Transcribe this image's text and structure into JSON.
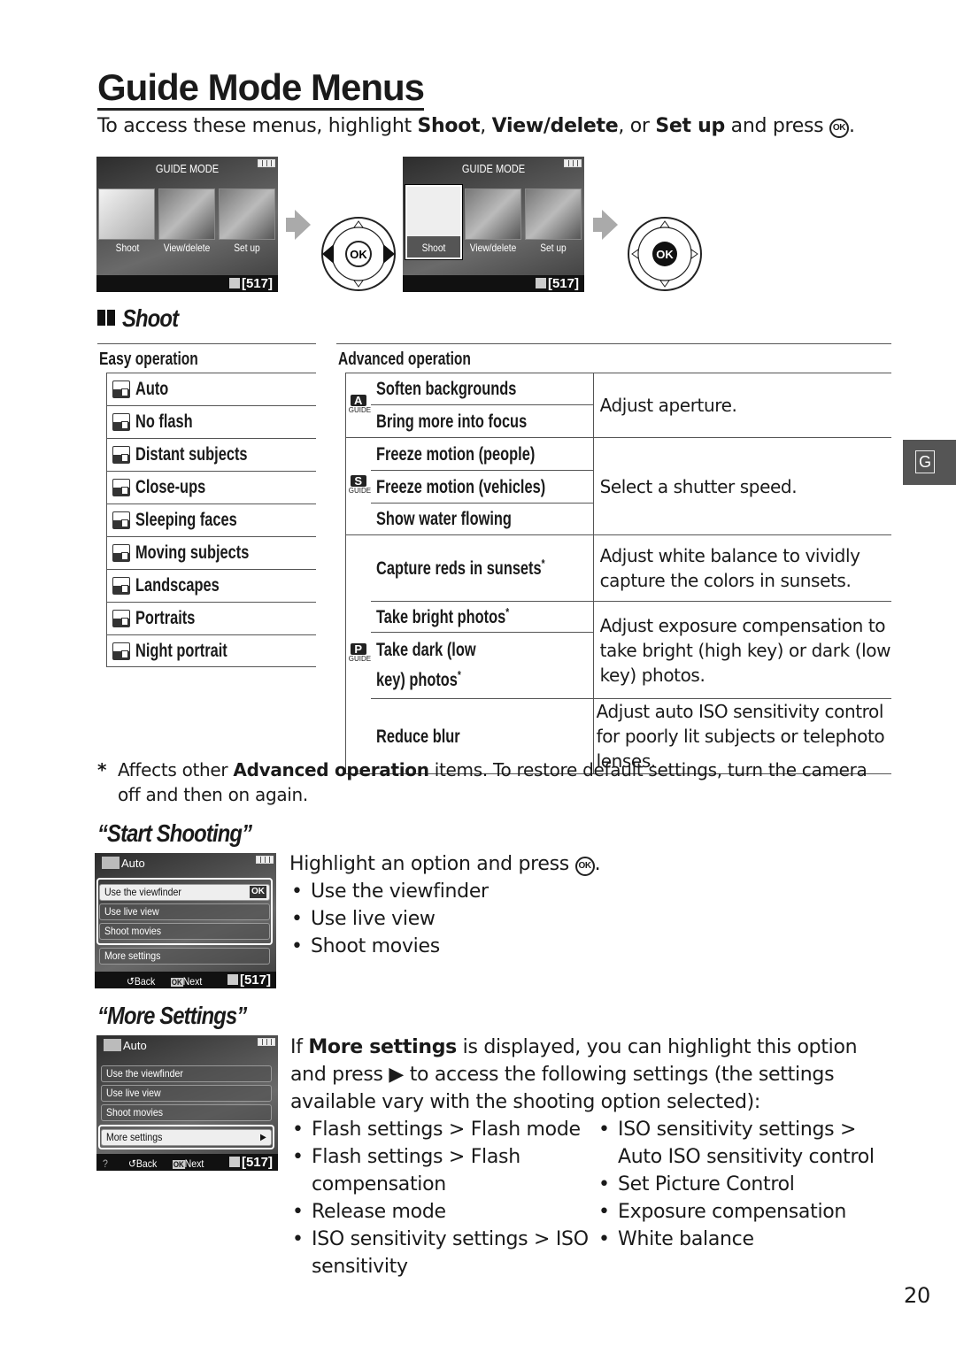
{
  "title": "Guide Mode Menus",
  "intro": {
    "t1": "To access these menus, highlight ",
    "b1": "Shoot",
    "t2": ", ",
    "b2": "View/delete",
    "t3": ", or ",
    "b3": "Set up",
    "t4": " and press ",
    "ok_icon": "OK",
    "t5": "."
  },
  "guide_screen": {
    "title": "GUIDE MODE",
    "items": [
      "Shoot",
      "View/delete",
      "Set up"
    ],
    "frames": "[517]"
  },
  "dial": {
    "ok_label": "OK"
  },
  "shoot": {
    "heading": "Shoot",
    "easy": {
      "header": "Easy operation",
      "items": [
        {
          "label": "Auto",
          "icon": "auto-mode-icon"
        },
        {
          "label": "No flash",
          "icon": "no-flash-icon"
        },
        {
          "label": "Distant subjects",
          "icon": "distant-subjects-icon"
        },
        {
          "label": "Close-ups",
          "icon": "close-ups-icon"
        },
        {
          "label": "Sleeping faces",
          "icon": "sleeping-faces-icon"
        },
        {
          "label": "Moving subjects",
          "icon": "moving-subjects-icon"
        },
        {
          "label": "Landscapes",
          "icon": "landscapes-icon"
        },
        {
          "label": "Portraits",
          "icon": "portraits-icon"
        },
        {
          "label": "Night portrait",
          "icon": "night-portrait-icon"
        }
      ]
    },
    "advanced": {
      "header": "Advanced operation",
      "guide_label": "GUIDE",
      "groups": [
        {
          "mode": "A",
          "items": [
            "Soften backgrounds",
            "Bring more into focus"
          ],
          "desc": "Adjust aperture."
        },
        {
          "mode": "S",
          "items": [
            "Freeze motion (people)",
            "Freeze motion (vehicles)",
            "Show water flowing"
          ],
          "desc": "Select a shutter speed."
        },
        {
          "mode": "P",
          "items": [
            "Capture reds in sunsets",
            "Take bright photos",
            "Take dark (low key) photos",
            "Reduce blur"
          ],
          "descs": [
            "Adjust white balance to vividly capture the colors in sunsets.",
            "Adjust exposure compensation to take bright (high key) or dark (low key) photos.",
            "Adjust auto ISO sensitivity control for poorly lit subjects or telephoto lenses."
          ]
        }
      ],
      "asterisk": "*"
    }
  },
  "footnote": {
    "mark": "*",
    "t1": "Affects other ",
    "b1": "Advanced operation",
    "t2": " items. To restore default settings, turn the camera off and then on again."
  },
  "start_shooting": {
    "heading": "“Start Shooting”",
    "screen": {
      "mode": "Auto",
      "options": [
        "Use the viewfinder",
        "Use live view",
        "Shoot movies"
      ],
      "more": "More settings",
      "back": "Back",
      "next": "Next",
      "ok_badge": "OK",
      "frames": "[517]"
    },
    "text": {
      "t1": "Highlight an option and press ",
      "ok_icon": "OK",
      "t2": "."
    },
    "bullets": [
      "Use the viewfinder",
      "Use live view",
      "Shoot movies"
    ]
  },
  "more_settings": {
    "heading": "“More Settings”",
    "screen": {
      "mode": "Auto",
      "options": [
        "Use the viewfinder",
        "Use live view",
        "Shoot movies"
      ],
      "more": "More settings",
      "help": "?",
      "back": "Back",
      "next": "Next",
      "frames": "[517]"
    },
    "text": {
      "t1": "If ",
      "b1": "More settings",
      "t2": " is displayed, you can highlight this option and press ",
      "arrow": "▶",
      "t3": " to access the following settings (the settings available vary with the shooting option selected):"
    },
    "bullets_left": [
      "Flash settings > Flash mode",
      "Flash settings > Flash compensation",
      "Release mode",
      "ISO sensitivity settings > ISO sensitivity"
    ],
    "bullets_right": [
      "ISO sensitivity settings > Auto ISO sensitivity control",
      "Set Picture Control",
      "Exposure compensation",
      "White balance"
    ]
  },
  "side_tab": "G",
  "page_number": "20"
}
